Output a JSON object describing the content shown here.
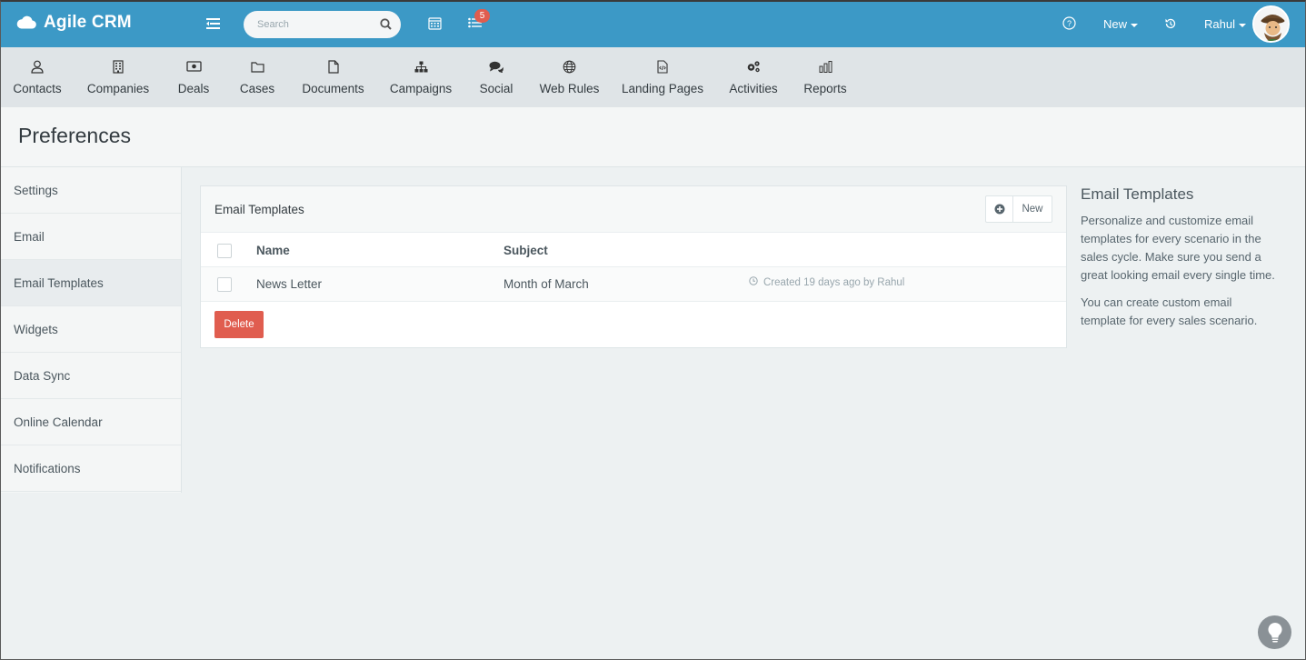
{
  "header": {
    "brand": "Agile CRM",
    "search_placeholder": "Search",
    "notifications_count": "5",
    "new_label": "New",
    "user_label": "Rahul"
  },
  "modules": [
    {
      "label": "Contacts",
      "icon": "user-icon"
    },
    {
      "label": "Companies",
      "icon": "building-icon"
    },
    {
      "label": "Deals",
      "icon": "money-icon"
    },
    {
      "label": "Cases",
      "icon": "folder-icon"
    },
    {
      "label": "Documents",
      "icon": "document-icon"
    },
    {
      "label": "Campaigns",
      "icon": "sitemap-icon"
    },
    {
      "label": "Social",
      "icon": "chat-icon"
    },
    {
      "label": "Web Rules",
      "icon": "globe-icon"
    },
    {
      "label": "Landing Pages",
      "icon": "code-file-icon"
    },
    {
      "label": "Activities",
      "icon": "gears-icon"
    },
    {
      "label": "Reports",
      "icon": "bar-chart-icon"
    }
  ],
  "page": {
    "title": "Preferences"
  },
  "sidebar": {
    "items": [
      {
        "label": "Settings"
      },
      {
        "label": "Email"
      },
      {
        "label": "Email Templates",
        "active": true
      },
      {
        "label": "Widgets"
      },
      {
        "label": "Data Sync"
      },
      {
        "label": "Online Calendar"
      },
      {
        "label": "Notifications"
      }
    ]
  },
  "panel": {
    "title": "Email Templates",
    "new_button": "New",
    "columns": {
      "name": "Name",
      "subject": "Subject"
    },
    "rows": [
      {
        "name": "News Letter",
        "subject": "Month of March",
        "meta": "Created 19 days ago by Rahul"
      }
    ],
    "delete_button": "Delete"
  },
  "help": {
    "title": "Email Templates",
    "paragraph1": "Personalize and customize email templates for every scenario in the sales cycle. Make sure you send a great looking email every single time.",
    "paragraph2": "You can create custom email template for every sales scenario."
  },
  "colors": {
    "header_bg": "#3c99c6",
    "modules_bg": "#dfe4e7",
    "delete_btn": "#e05d4f",
    "badge": "#e05d4f"
  }
}
